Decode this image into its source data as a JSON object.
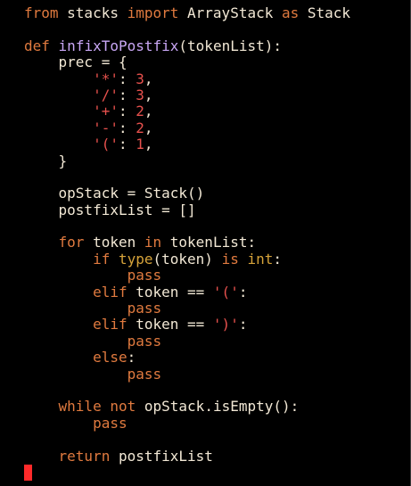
{
  "editor": {
    "code_lines": [
      [
        {
          "t": "from",
          "c": "kw"
        },
        {
          "t": " stacks ",
          "c": "pl"
        },
        {
          "t": "import",
          "c": "kw"
        },
        {
          "t": " ArrayStack ",
          "c": "pl"
        },
        {
          "t": "as",
          "c": "kw"
        },
        {
          "t": " Stack",
          "c": "pl"
        }
      ],
      [],
      [
        {
          "t": "def",
          "c": "kw"
        },
        {
          "t": " ",
          "c": "pl"
        },
        {
          "t": "infixToPostfix",
          "c": "fn"
        },
        {
          "t": "(tokenList):",
          "c": "pl"
        }
      ],
      [
        {
          "t": "    prec = {",
          "c": "pl"
        }
      ],
      [
        {
          "t": "        ",
          "c": "pl"
        },
        {
          "t": "'*'",
          "c": "st"
        },
        {
          "t": ": ",
          "c": "pl"
        },
        {
          "t": "3",
          "c": "nm"
        },
        {
          "t": ",",
          "c": "pl"
        }
      ],
      [
        {
          "t": "        ",
          "c": "pl"
        },
        {
          "t": "'/'",
          "c": "st"
        },
        {
          "t": ": ",
          "c": "pl"
        },
        {
          "t": "3",
          "c": "nm"
        },
        {
          "t": ",",
          "c": "pl"
        }
      ],
      [
        {
          "t": "        ",
          "c": "pl"
        },
        {
          "t": "'+'",
          "c": "st"
        },
        {
          "t": ": ",
          "c": "pl"
        },
        {
          "t": "2",
          "c": "nm"
        },
        {
          "t": ",",
          "c": "pl"
        }
      ],
      [
        {
          "t": "        ",
          "c": "pl"
        },
        {
          "t": "'-'",
          "c": "st"
        },
        {
          "t": ": ",
          "c": "pl"
        },
        {
          "t": "2",
          "c": "nm"
        },
        {
          "t": ",",
          "c": "pl"
        }
      ],
      [
        {
          "t": "        ",
          "c": "pl"
        },
        {
          "t": "'('",
          "c": "st"
        },
        {
          "t": ": ",
          "c": "pl"
        },
        {
          "t": "1",
          "c": "nm"
        },
        {
          "t": ",",
          "c": "pl"
        }
      ],
      [
        {
          "t": "    }",
          "c": "pl"
        }
      ],
      [],
      [
        {
          "t": "    opStack = Stack()",
          "c": "pl"
        }
      ],
      [
        {
          "t": "    postfixList = []",
          "c": "pl"
        }
      ],
      [],
      [
        {
          "t": "    ",
          "c": "pl"
        },
        {
          "t": "for",
          "c": "kw"
        },
        {
          "t": " token ",
          "c": "pl"
        },
        {
          "t": "in",
          "c": "kw"
        },
        {
          "t": " tokenList:",
          "c": "pl"
        }
      ],
      [
        {
          "t": "        ",
          "c": "pl"
        },
        {
          "t": "if",
          "c": "kw"
        },
        {
          "t": " ",
          "c": "pl"
        },
        {
          "t": "type",
          "c": "bi"
        },
        {
          "t": "(token) ",
          "c": "pl"
        },
        {
          "t": "is",
          "c": "kw"
        },
        {
          "t": " ",
          "c": "pl"
        },
        {
          "t": "int",
          "c": "bi"
        },
        {
          "t": ":",
          "c": "pl"
        }
      ],
      [
        {
          "t": "            ",
          "c": "pl"
        },
        {
          "t": "pass",
          "c": "kw"
        }
      ],
      [
        {
          "t": "        ",
          "c": "pl"
        },
        {
          "t": "elif",
          "c": "kw"
        },
        {
          "t": " token == ",
          "c": "pl"
        },
        {
          "t": "'('",
          "c": "st"
        },
        {
          "t": ":",
          "c": "pl"
        }
      ],
      [
        {
          "t": "            ",
          "c": "pl"
        },
        {
          "t": "pass",
          "c": "kw"
        }
      ],
      [
        {
          "t": "        ",
          "c": "pl"
        },
        {
          "t": "elif",
          "c": "kw"
        },
        {
          "t": " token == ",
          "c": "pl"
        },
        {
          "t": "')'",
          "c": "st"
        },
        {
          "t": ":",
          "c": "pl"
        }
      ],
      [
        {
          "t": "            ",
          "c": "pl"
        },
        {
          "t": "pass",
          "c": "kw"
        }
      ],
      [
        {
          "t": "        ",
          "c": "pl"
        },
        {
          "t": "else",
          "c": "kw"
        },
        {
          "t": ":",
          "c": "pl"
        }
      ],
      [
        {
          "t": "            ",
          "c": "pl"
        },
        {
          "t": "pass",
          "c": "kw"
        }
      ],
      [],
      [
        {
          "t": "    ",
          "c": "pl"
        },
        {
          "t": "while",
          "c": "kw"
        },
        {
          "t": " ",
          "c": "pl"
        },
        {
          "t": "not",
          "c": "kw"
        },
        {
          "t": " opStack.isEmpty():",
          "c": "pl"
        }
      ],
      [
        {
          "t": "        ",
          "c": "pl"
        },
        {
          "t": "pass",
          "c": "kw"
        }
      ],
      [],
      [
        {
          "t": "    ",
          "c": "pl"
        },
        {
          "t": "return",
          "c": "kw"
        },
        {
          "t": " postfixList",
          "c": "pl"
        }
      ]
    ],
    "syntax_colors": {
      "keyword": "#e07a3f",
      "function_name": "#c9a7f5",
      "builtin": "#d6a33a",
      "string": "#e7514d",
      "number": "#e7514d",
      "plain": "#f2e8d5",
      "background": "#000000",
      "cursor": "#ff2a2a"
    }
  }
}
